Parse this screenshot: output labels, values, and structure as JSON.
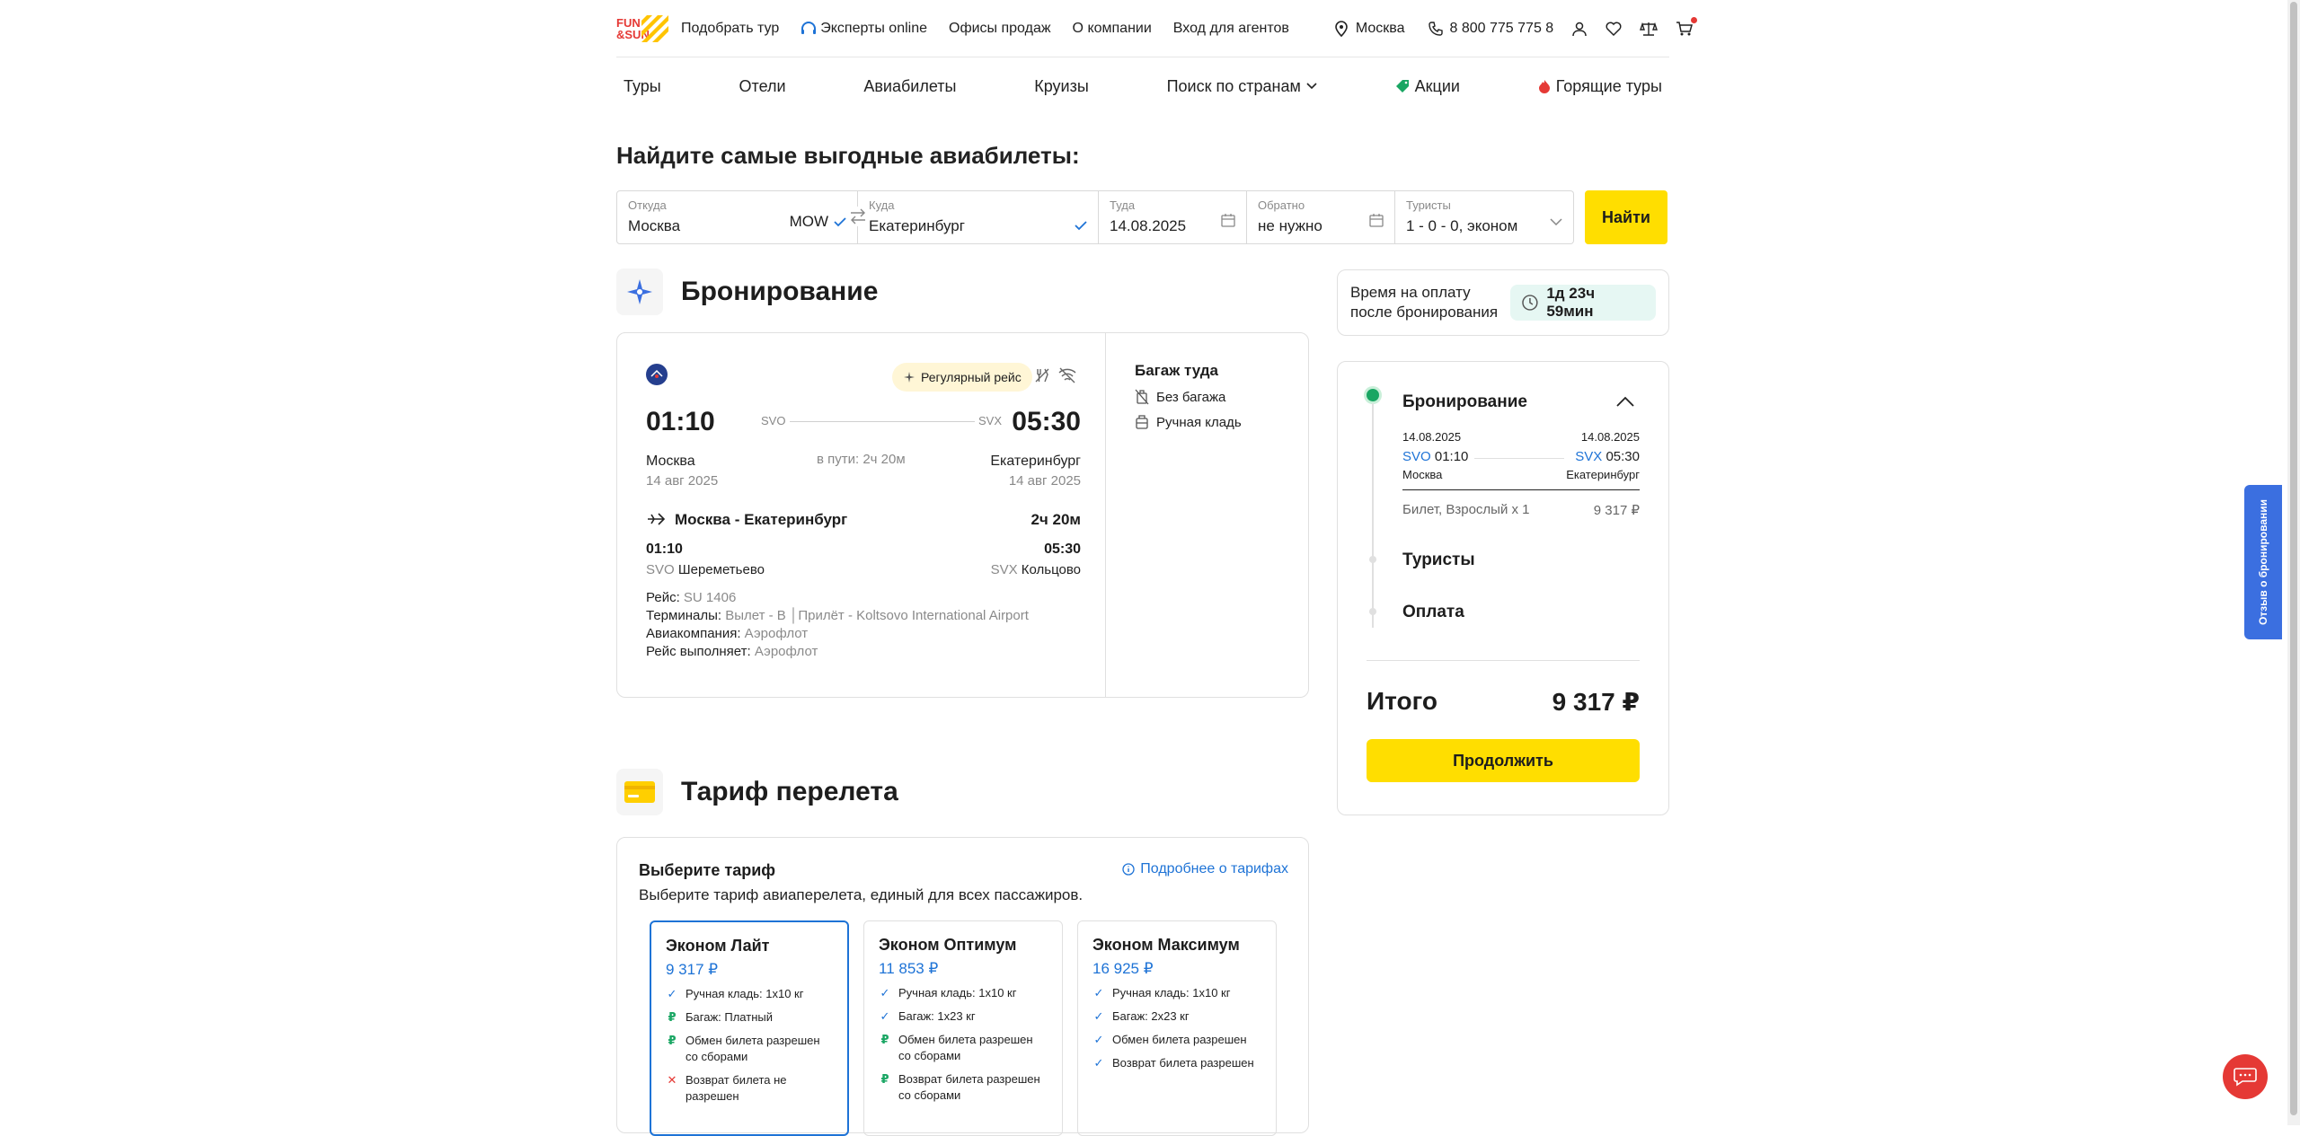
{
  "header": {
    "logo_text": "FUN&SUN",
    "nav": [
      "Подобрать тур",
      "Эксперты online",
      "Офисы продаж",
      "О компании",
      "Вход для агентов"
    ],
    "city": "Москва",
    "phone": "8 800 775 775 8"
  },
  "main_nav": {
    "items": [
      "Туры",
      "Отели",
      "Авиабилеты",
      "Круизы",
      "Поиск по странам",
      "Акции",
      "Горящие туры"
    ]
  },
  "page_title": "Найдите самые выгодные авиабилеты:",
  "search": {
    "from_label": "Откуда",
    "from_value": "Москва",
    "from_code": "MOW",
    "to_label": "Куда",
    "to_value": "Екатеринбург",
    "there_label": "Туда",
    "there_value": "14.08.2025",
    "back_label": "Обратно",
    "back_value": "не нужно",
    "tourists_label": "Туристы",
    "tourists_value": "1 - 0 - 0, эконом",
    "find_button": "Найти"
  },
  "booking": {
    "title": "Бронирование",
    "badge": "Регулярный рейс",
    "dep_time": "01:10",
    "arr_time": "05:30",
    "dep_code": "SVO",
    "arr_code": "SVX",
    "dep_city": "Москва",
    "arr_city": "Екатеринбург",
    "dep_date": "14 авг 2025",
    "arr_date": "14 авг 2025",
    "duration": "в пути: 2ч 20м",
    "segment_title": "Москва - Екатеринбург",
    "segment_duration": "2ч 20м",
    "seg_dep_time": "01:10",
    "seg_arr_time": "05:30",
    "seg_dep_code": "SVO",
    "seg_dep_airport": "Шереметьево",
    "seg_arr_code": "SVX",
    "seg_arr_airport": "Кольцово",
    "flight_label": "Рейс:",
    "flight_value": "SU 1406",
    "terminals_label": "Терминалы:",
    "terminals_value": "Вылет - B │Прилёт - Koltsovo International Airport",
    "airline_label": "Авиакомпания:",
    "airline_value": "Аэрофлот",
    "operated_label": "Рейс выполняет:",
    "operated_value": "Аэрофлот",
    "baggage_title": "Багаж туда",
    "baggage_none": "Без багажа",
    "hand_luggage": "Ручная кладь"
  },
  "payment_time": {
    "label": "Время на оплату после бронирования",
    "value": "1д 23ч 59мин"
  },
  "summary": {
    "step1": "Бронирование",
    "dep_date": "14.08.2025",
    "arr_date": "14.08.2025",
    "dep_code": "SVO",
    "dep_time": "01:10",
    "arr_code": "SVX",
    "arr_time": "05:30",
    "dep_city": "Москва",
    "arr_city": "Екатеринбург",
    "ticket_label": "Билет, Взрослый x 1",
    "ticket_price": "9 317 ₽",
    "step2": "Туристы",
    "step3": "Оплата",
    "total_label": "Итого",
    "total_value": "9 317 ₽",
    "continue_button": "Продолжить"
  },
  "tariff": {
    "title": "Тариф перелета",
    "choose": "Выберите тариф",
    "more_link": "Подробнее о тарифах",
    "subtitle": "Выберите тариф авиаперелета, единый для всех пассажиров.",
    "plans": [
      {
        "name": "Эконом Лайт",
        "price": "9 317 ₽",
        "features": [
          "Ручная кладь: 1x10 кг",
          "Багаж: Платный",
          "Обмен билета разрешен со сборами",
          "Возврат билета не разрешен"
        ]
      },
      {
        "name": "Эконом Оптимум",
        "price": "11 853 ₽",
        "features": [
          "Ручная кладь: 1x10 кг",
          "Багаж: 1x23 кг",
          "Обмен билета разрешен со сборами",
          "Возврат билета разрешен со сборами"
        ]
      },
      {
        "name": "Эконом Максимум",
        "price": "16 925 ₽",
        "features": [
          "Ручная кладь: 1x10 кг",
          "Багаж: 2x23 кг",
          "Обмен билета разрешен",
          "Возврат билета разрешен"
        ]
      }
    ]
  },
  "feedback_tab": "Отзыв о бронировании",
  "colors": {
    "accent": "#ffde00",
    "link": "#1e73d6",
    "success": "#19a663",
    "danger": "#e53935"
  }
}
